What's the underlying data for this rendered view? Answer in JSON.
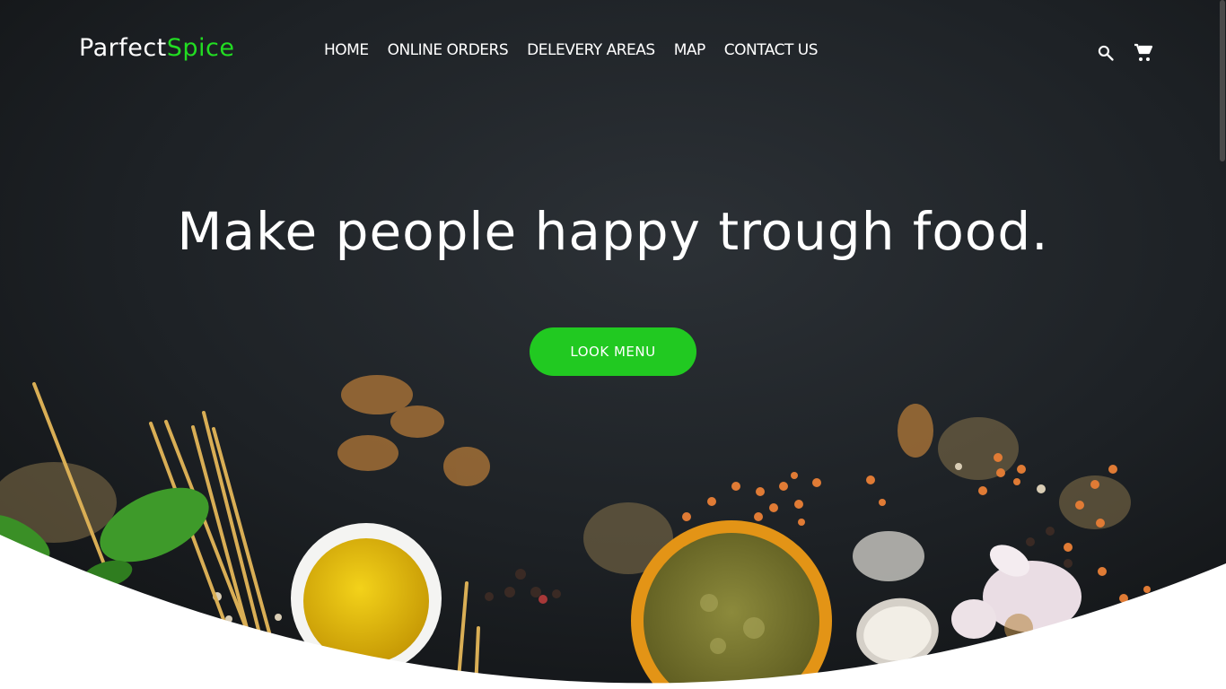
{
  "logo": {
    "part1": "Parfect",
    "part2": "Spice"
  },
  "nav": {
    "items": [
      {
        "label": "HOME"
      },
      {
        "label": "ONLINE ORDERS"
      },
      {
        "label": "DELEVERY AREAS"
      },
      {
        "label": "MAP"
      },
      {
        "label": "CONTACT US"
      }
    ]
  },
  "icons": {
    "search": "search-icon",
    "cart": "cart-icon"
  },
  "hero": {
    "headline": "Make people happy trough food.",
    "cta_label": "LOOK MENU"
  },
  "colors": {
    "accent": "#22dd22",
    "button": "#21c921",
    "background_dark": "#1c1f22",
    "text": "#ffffff"
  }
}
